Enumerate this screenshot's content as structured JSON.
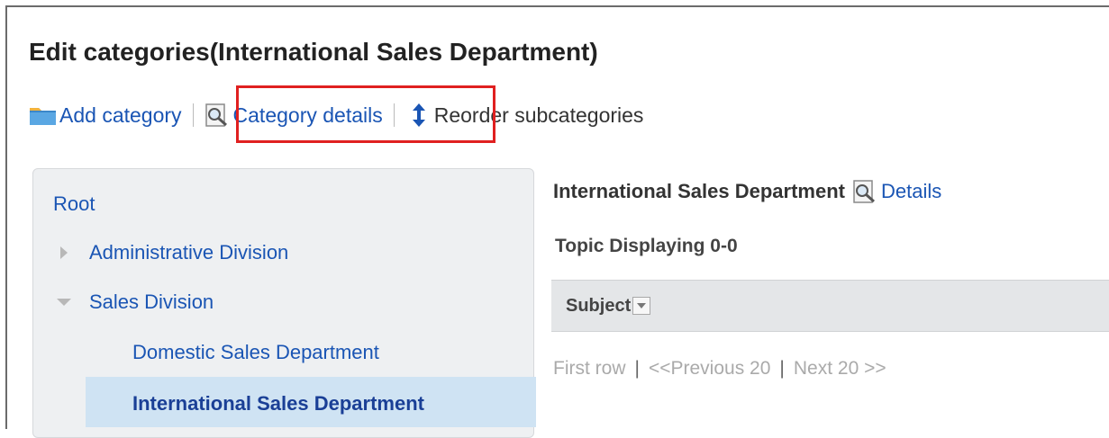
{
  "header": {
    "title": "Edit categories(International Sales Department)"
  },
  "toolbar": {
    "add_category": "Add category",
    "category_details": "Category details",
    "reorder_subcategories": "Reorder subcategories"
  },
  "tree": {
    "root": "Root",
    "items": [
      {
        "label": "Administrative Division",
        "state": "collapsed"
      },
      {
        "label": "Sales Division",
        "state": "expanded"
      },
      {
        "label": "Domestic Sales Department",
        "state": "leaf"
      },
      {
        "label": "International Sales Department",
        "state": "selected"
      }
    ]
  },
  "main": {
    "category_title": "International Sales Department",
    "details_link": "Details",
    "topic_count": "Topic Displaying 0-0",
    "table": {
      "column_subject": "Subject"
    },
    "pager": {
      "first": "First row",
      "separator": "|",
      "previous": "<<Previous 20",
      "next": "Next 20 >>"
    }
  },
  "colors": {
    "link": "#1a55b4",
    "highlight_box": "#e02020",
    "selected_row": "#cfe3f3",
    "panel_bg": "#eef0f2"
  }
}
